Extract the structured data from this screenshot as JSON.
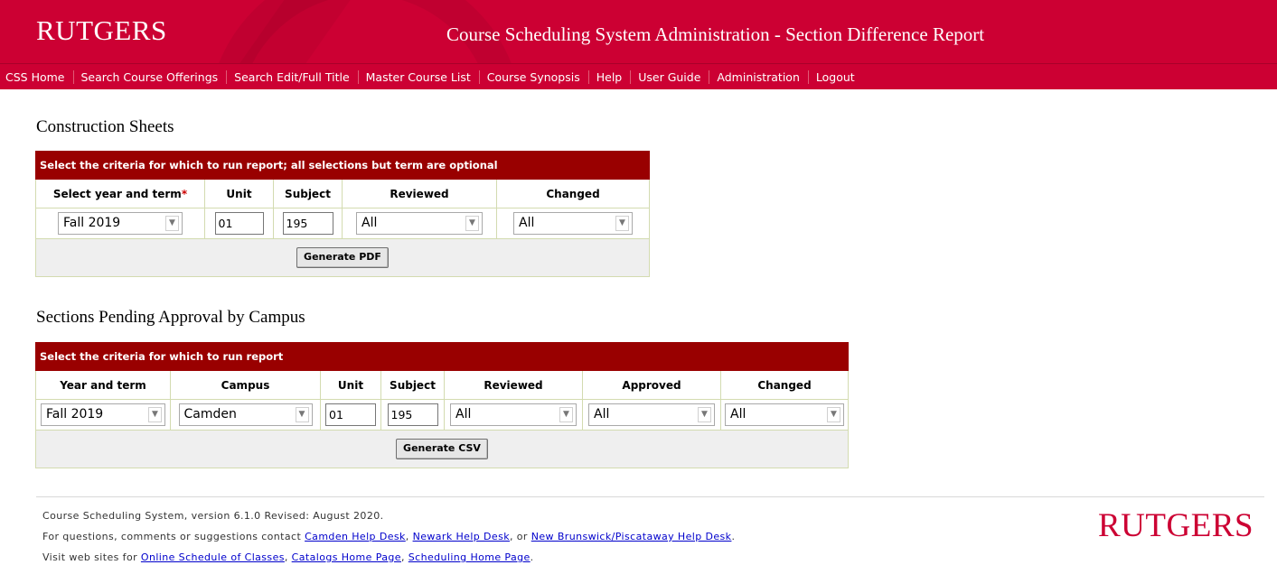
{
  "header": {
    "logo": "RUTGERS",
    "title": "Course Scheduling System Administration - Section Difference Report"
  },
  "nav": [
    "CSS Home",
    "Search Course Offerings",
    "Search Edit/Full Title",
    "Master Course List",
    "Course Synopsis",
    "Help",
    "User Guide",
    "Administration",
    "Logout"
  ],
  "construction": {
    "title": "Construction Sheets",
    "caption": "Select the criteria for which to run report; all selections but term are optional",
    "headers": {
      "year_term": "Select year and term",
      "required_mark": "*",
      "unit": "Unit",
      "subject": "Subject",
      "reviewed": "Reviewed",
      "changed": "Changed"
    },
    "values": {
      "year_term": "Fall 2019",
      "unit": "01",
      "subject": "195",
      "reviewed": "All",
      "changed": "All"
    },
    "button": "Generate PDF"
  },
  "pending": {
    "title": "Sections Pending Approval by Campus",
    "caption": "Select the criteria for which to run report",
    "headers": {
      "year_term": "Year and term",
      "campus": "Campus",
      "unit": "Unit",
      "subject": "Subject",
      "reviewed": "Reviewed",
      "approved": "Approved",
      "changed": "Changed"
    },
    "values": {
      "year_term": "Fall 2019",
      "campus": "Camden",
      "unit": "01",
      "subject": "195",
      "reviewed": "All",
      "approved": "All",
      "changed": "All"
    },
    "button": "Generate CSV"
  },
  "footer": {
    "version": "Course Scheduling System, version 6.1.0 Revised: August 2020.",
    "contact_prefix": "For questions, comments or suggestions contact ",
    "camden_help": "Camden Help Desk",
    "sep1": ", ",
    "newark_help": "Newark Help Desk",
    "sep2": ", or ",
    "nb_help": "New Brunswick/Piscataway Help Desk",
    "end": ".",
    "visit_prefix": "Visit web sites for ",
    "soc": "Online Schedule of Classes",
    "sep3": ", ",
    "catalogs": "Catalogs Home Page",
    "sep4": ", ",
    "scheduling": "Scheduling Home Page",
    "logo": "RUTGERS"
  },
  "colors": {
    "brand_red": "#cc0033",
    "caption_red": "#990000",
    "link_blue": "#0000cc"
  },
  "icons": {
    "dropdown": "chevron-down-icon"
  }
}
